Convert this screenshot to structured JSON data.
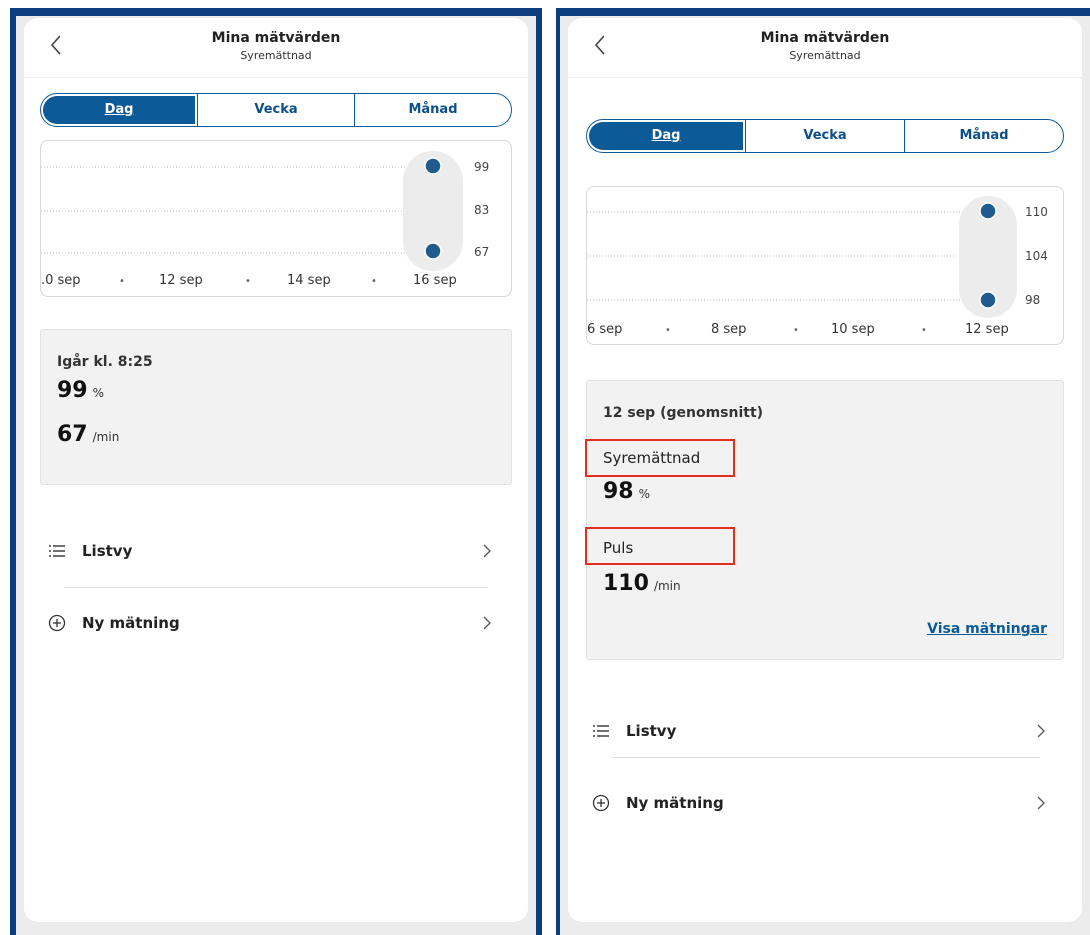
{
  "colors": {
    "frame": "#0d3f80",
    "primary": "#0d5a99",
    "highlight": "#e0301e",
    "dot": "#1f5b8c"
  },
  "screens": [
    {
      "header": {
        "title": "Mina mätvärden",
        "subtitle": "Syremättnad"
      },
      "tabs": [
        "Dag",
        "Vecka",
        "Månad"
      ],
      "chart": {
        "y_ticks": [
          "99",
          "83",
          "67"
        ],
        "x_ticks": [
          ".0 sep",
          "•",
          "12 sep",
          "•",
          "14 sep",
          "•",
          "16 sep"
        ]
      },
      "summary": {
        "heading": "Igår kl. 8:25",
        "spo2": {
          "value": "99",
          "unit": "%"
        },
        "pulse": {
          "value": "67",
          "unit": "/min"
        }
      },
      "menu": [
        {
          "label": "Listvy",
          "icon": "list-icon"
        },
        {
          "label": "Ny mätning",
          "icon": "plus-circle-icon"
        }
      ]
    },
    {
      "header": {
        "title": "Mina mätvärden",
        "subtitle": "Syremättnad"
      },
      "tabs": [
        "Dag",
        "Vecka",
        "Månad"
      ],
      "chart": {
        "y_ticks": [
          "110",
          "104",
          "98"
        ],
        "x_ticks": [
          "6 sep",
          "•",
          "8 sep",
          "•",
          "10 sep",
          "•",
          "12 sep"
        ]
      },
      "summary": {
        "heading": "12 sep (genomsnitt)",
        "spo2_label": "Syremättnad",
        "spo2": {
          "value": "98",
          "unit": "%"
        },
        "pulse_label": "Puls",
        "pulse": {
          "value": "110",
          "unit": "/min"
        },
        "link": "Visa mätningar"
      },
      "menu": [
        {
          "label": "Listvy",
          "icon": "list-icon"
        },
        {
          "label": "Ny mätning",
          "icon": "plus-circle-icon"
        }
      ]
    }
  ]
}
